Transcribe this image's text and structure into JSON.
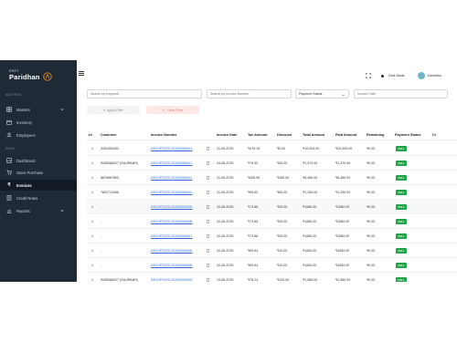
{
  "brand": {
    "sup": "ERET",
    "name": "Paridhan"
  },
  "sidebar": {
    "sections": [
      "MASTERS",
      "INVOI"
    ],
    "items": [
      {
        "label": "Masters",
        "icon": "grid-icon"
      },
      {
        "label": "Inventory",
        "icon": "box-icon"
      },
      {
        "label": "Employees",
        "icon": "users-icon"
      },
      {
        "label": "Dashboard",
        "icon": "dashboard-icon"
      },
      {
        "label": "Stock Purchase",
        "icon": "cart-icon"
      },
      {
        "label": "Invoices",
        "icon": "rupee-icon"
      },
      {
        "label": "Credit Notes",
        "icon": "note-icon"
      },
      {
        "label": "Reports",
        "icon": "chart-icon"
      }
    ]
  },
  "topbar": {
    "dark_mode_label": "Dark Mode",
    "user_name": "Kanishka"
  },
  "filters": {
    "keyword_placeholder": "Search by Keyword ...",
    "invoice_placeholder": "Search by Invoice Number",
    "status_value": "Payment Status",
    "date_placeholder": "Invoice Date",
    "apply_label": "Apply Filter",
    "clear_label": "Clear Filter"
  },
  "table": {
    "headers": [
      "-id",
      "Customer",
      "Invoice Number",
      "Invoice Date",
      "Tax Amount",
      "Discount",
      "Total Amount",
      "Paid Amount",
      "Remaining",
      "Payment Status",
      "Cr"
    ],
    "rows": [
      {
        "id": "1",
        "customer": "3454353454",
        "invoice": "INV/OP/2025-2026/0000013",
        "date": "21-06-2025",
        "tax": "₹476.19",
        "discount": "₹0.00",
        "total": "₹10,000.00",
        "paid": "₹10,000.00",
        "remaining": "₹0.00",
        "status": "FULL"
      },
      {
        "id": "1",
        "customer": "9495368927 (SAURABH)",
        "invoice": "INV/OP/2025-2026/0000012",
        "date": "24-06-2025",
        "tax": "₹79.52",
        "discount": "₹30.00",
        "total": "₹1,570.00",
        "paid": "₹1,570.00",
        "remaining": "₹0.00",
        "status": "FULL"
      },
      {
        "id": "1",
        "customer": "8876967890",
        "invoice": "INV/OP/2025-2026/0000011",
        "date": "21-06-2025",
        "tax": "₹405.95",
        "discount": "₹150.00",
        "total": "₹8,450.00",
        "paid": "₹8,450.00",
        "remaining": "₹0.00",
        "status": "FULL"
      },
      {
        "id": "1",
        "customer": "7891723456",
        "invoice": "INV/OP/2025-2026/0000010",
        "date": "21-06-2025",
        "tax": "₹59.62",
        "discount": "₹60.00",
        "total": "₹1,250.00",
        "paid": "₹1,250.00",
        "remaining": "₹0.00",
        "status": "FULL"
      },
      {
        "id": "1",
        "customer": "-",
        "invoice": "INV/OP/2025-2026/0000009",
        "date": "20-06-2025",
        "tax": "₹73.85",
        "discount": "₹20.00",
        "total": "₹1580.00",
        "paid": "₹1580.00",
        "remaining": "₹0.00",
        "status": "FULL"
      },
      {
        "id": "1",
        "customer": "-",
        "invoice": "INV/OP/2025-2026/0000008",
        "date": "20-06-2025",
        "tax": "₹73.85",
        "discount": "₹20.00",
        "total": "₹1580.00",
        "paid": "₹1580.00",
        "remaining": "₹0.00",
        "status": "FULL"
      },
      {
        "id": "1",
        "customer": "-",
        "invoice": "INV/OP/2025-2026/0000007",
        "date": "20-06-2025",
        "tax": "₹73.86",
        "discount": "₹20.00",
        "total": "₹1580.00",
        "paid": "₹1580.00",
        "remaining": "₹0.00",
        "status": "FULL"
      },
      {
        "id": "1",
        "customer": "-",
        "invoice": "INV/OP/2025-2026/0000006",
        "date": "20-06-2025",
        "tax": "₹69.64",
        "discount": "₹10.00",
        "total": "₹1550.00",
        "paid": "₹1550.00",
        "remaining": "₹0.00",
        "status": "FULL"
      },
      {
        "id": "1",
        "customer": "-",
        "invoice": "INV/OP/2025-2026/0000005",
        "date": "20-06-2025",
        "tax": "₹69.64",
        "discount": "₹10.00",
        "total": "₹1550.00",
        "paid": "₹1550.00",
        "remaining": "₹0.00",
        "status": "FULL"
      },
      {
        "id": "1",
        "customer": "9495368927 (SAURABH)",
        "invoice": "INV/OP/2025-2026/0000002",
        "date": "19-06-2025",
        "tax": "₹75.24",
        "discount": "₹120.00",
        "total": "₹1,580.00",
        "paid": "₹1,580.00",
        "remaining": "₹0.00",
        "status": "FULL"
      }
    ]
  }
}
